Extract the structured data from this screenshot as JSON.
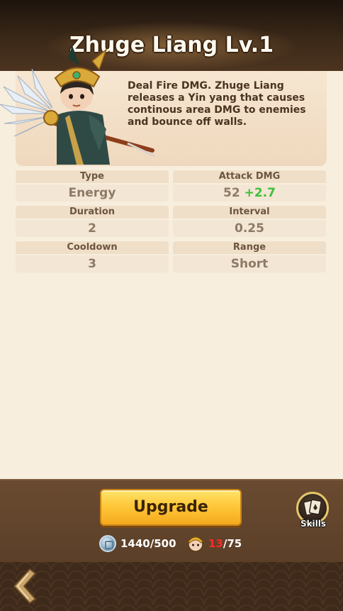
{
  "header": {
    "title": "Zhuge Liang Lv.1"
  },
  "hero": {
    "portrait_icon": "hero-portrait",
    "description": "Deal Fire DMG. Zhuge Liang releases a Yin yang that causes continous area DMG to enemies and bounce off walls."
  },
  "stats": [
    {
      "label": "Type",
      "value": "Energy"
    },
    {
      "label": "Attack DMG",
      "value": "52",
      "bonus": "+2.7"
    },
    {
      "label": "Duration",
      "value": "2"
    },
    {
      "label": "Interval",
      "value": "0.25"
    },
    {
      "label": "Cooldown",
      "value": "3"
    },
    {
      "label": "Range",
      "value": "Short"
    }
  ],
  "actions": {
    "upgrade_label": "Upgrade",
    "skills_label": "Skills"
  },
  "cost": {
    "coins": "1440/500",
    "shards_have": "13",
    "shards_sep_need": "/75"
  },
  "colors": {
    "accent_gold": "#ffc83a",
    "bonus_green": "#3fbf3a",
    "insufficient_red": "#ff2a2a",
    "panel_brown": "#5b3f28"
  },
  "icons": {
    "back": "back-arrow-icon",
    "coin": "coin-icon",
    "shard": "hero-token-icon",
    "skills": "skills-cards-icon"
  }
}
